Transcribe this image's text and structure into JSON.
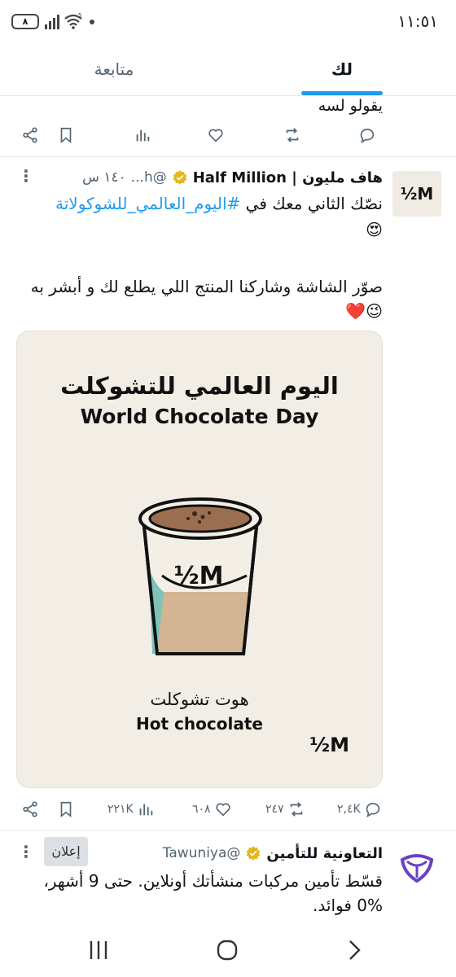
{
  "status_bar": {
    "time": "١١:٥١",
    "battery": "٨",
    "wifi_label": "5"
  },
  "tabs": {
    "for_you": "لك",
    "following": "متابعة"
  },
  "previous_tweet": {
    "partial_text": "يقولو لسه"
  },
  "tweet": {
    "avatar_text": "½M",
    "name": "هاف مليون | Half Million",
    "handle": "@h...",
    "time": "١٤٠ س",
    "line1_text": "نصّك الثاني معك في ",
    "line1_hashtag": "#اليوم_العالمي_للشوكولاتة",
    "line2_emoji": "😍",
    "line3_text": "صوّر الشاشة وشاركنا المنتج اللي يطلع لك و أبشر به",
    "line4_emoji": "😉❤️",
    "media": {
      "title_ar": "اليوم العالمي للتشوكلت",
      "title_en": "World Chocolate Day",
      "cup_logo": "½M",
      "product_ar": "هوت تشوكلت",
      "product_en": "Hot chocolate",
      "corner_logo": "½M"
    },
    "stats": {
      "replies": "٢,٤K",
      "retweets": "٢٤٧",
      "likes": "٦٠٨",
      "views": "٢٢١K"
    }
  },
  "ad_tweet": {
    "name": "التعاونية للتأمين",
    "handle": "@Tawuniya",
    "ad_label": "إعلان",
    "line1": "قسّط تأمين مركبات منشأتك أونلاين. حتى 9 أشهر،",
    "line2": "0% فوائد."
  },
  "colors": {
    "accent": "#1d9bf0",
    "verified_gold": "#e2b719",
    "muted": "#536471"
  }
}
